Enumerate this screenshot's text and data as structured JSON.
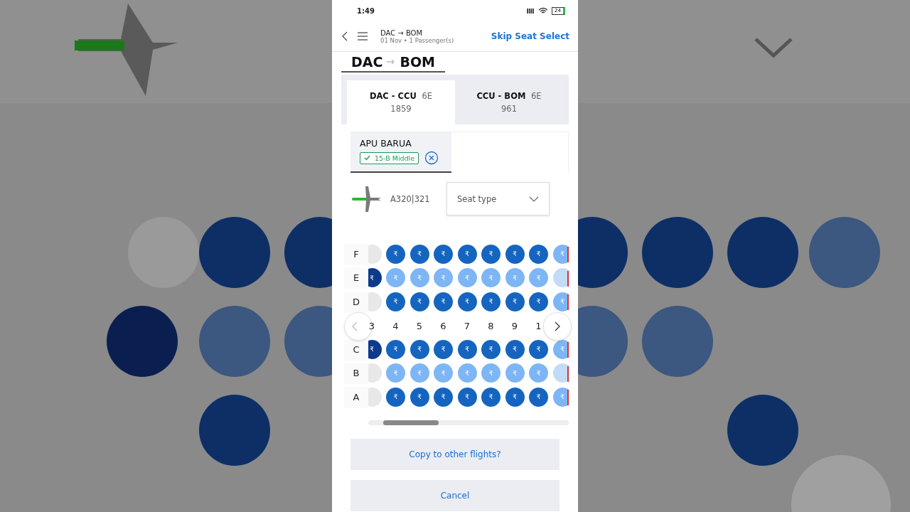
{
  "backdrop": {
    "kind": "picture"
  },
  "status_bar": {
    "time": "1:49",
    "battery": "24"
  },
  "header": {
    "route": "DAC → BOM",
    "subtitle": "01 Nov • 1 Passenger(s)",
    "skip": "Skip Seat Select"
  },
  "route_title": {
    "from": "DAC",
    "to": "BOM"
  },
  "flight_tabs": [
    {
      "route": "DAC - CCU",
      "carrier": "6E",
      "number": "1859",
      "selected": true
    },
    {
      "route": "CCU - BOM",
      "carrier": "6E",
      "number": "961",
      "selected": false
    }
  ],
  "passengers": [
    {
      "name": "APU BARUA",
      "seat": "15-B Middle",
      "selected": true
    }
  ],
  "aircraft": {
    "model": "A320|321",
    "seat_type_placeholder": "Seat type"
  },
  "seat_rows_top": [
    {
      "label": "F",
      "seats": [
        {
          "kind": "empty"
        },
        {
          "kind": "dark",
          "label": "₹"
        },
        {
          "kind": "dark",
          "label": "₹"
        },
        {
          "kind": "dark",
          "label": "₹"
        },
        {
          "kind": "dark",
          "label": "₹"
        },
        {
          "kind": "dark",
          "label": "₹"
        },
        {
          "kind": "dark",
          "label": "₹"
        },
        {
          "kind": "dark",
          "label": "₹"
        },
        {
          "kind": "light",
          "label": "₹"
        }
      ]
    },
    {
      "label": "E",
      "seats": [
        {
          "kind": "deep",
          "label": "₹"
        },
        {
          "kind": "light",
          "label": "₹"
        },
        {
          "kind": "light",
          "label": "₹"
        },
        {
          "kind": "light",
          "label": "₹"
        },
        {
          "kind": "light",
          "label": "₹"
        },
        {
          "kind": "light",
          "label": "₹"
        },
        {
          "kind": "light",
          "label": "₹"
        },
        {
          "kind": "light",
          "label": "₹"
        },
        {
          "kind": "pale"
        }
      ]
    },
    {
      "label": "D",
      "seats": [
        {
          "kind": "empty"
        },
        {
          "kind": "dark",
          "label": "₹"
        },
        {
          "kind": "dark",
          "label": "₹"
        },
        {
          "kind": "dark",
          "label": "₹"
        },
        {
          "kind": "dark",
          "label": "₹"
        },
        {
          "kind": "dark",
          "label": "₹"
        },
        {
          "kind": "dark",
          "label": "₹"
        },
        {
          "kind": "dark",
          "label": "₹"
        },
        {
          "kind": "light",
          "label": "₹"
        }
      ]
    }
  ],
  "column_numbers": [
    "3",
    "4",
    "5",
    "6",
    "7",
    "8",
    "9",
    "1"
  ],
  "seat_rows_bottom": [
    {
      "label": "C",
      "seats": [
        {
          "kind": "deep",
          "label": "₹"
        },
        {
          "kind": "dark",
          "label": "₹"
        },
        {
          "kind": "dark",
          "label": "₹"
        },
        {
          "kind": "dark",
          "label": "₹"
        },
        {
          "kind": "dark",
          "label": "₹"
        },
        {
          "kind": "dark",
          "label": "₹"
        },
        {
          "kind": "dark",
          "label": "₹"
        },
        {
          "kind": "dark",
          "label": "₹"
        },
        {
          "kind": "light",
          "label": "₹"
        }
      ]
    },
    {
      "label": "B",
      "seats": [
        {
          "kind": "empty"
        },
        {
          "kind": "light",
          "label": "₹"
        },
        {
          "kind": "light",
          "label": "₹"
        },
        {
          "kind": "light",
          "label": "₹"
        },
        {
          "kind": "light",
          "label": "₹"
        },
        {
          "kind": "light",
          "label": "₹"
        },
        {
          "kind": "light",
          "label": "₹"
        },
        {
          "kind": "light",
          "label": "₹"
        },
        {
          "kind": "pale"
        }
      ]
    },
    {
      "label": "A",
      "seats": [
        {
          "kind": "empty"
        },
        {
          "kind": "dark",
          "label": "₹"
        },
        {
          "kind": "dark",
          "label": "₹"
        },
        {
          "kind": "dark",
          "label": "₹"
        },
        {
          "kind": "dark",
          "label": "₹"
        },
        {
          "kind": "dark",
          "label": "₹"
        },
        {
          "kind": "dark",
          "label": "₹"
        },
        {
          "kind": "dark",
          "label": "₹"
        },
        {
          "kind": "light",
          "label": "₹"
        }
      ]
    }
  ],
  "buttons": [
    {
      "label": "Copy to other flights?"
    },
    {
      "label": "Cancel"
    }
  ]
}
